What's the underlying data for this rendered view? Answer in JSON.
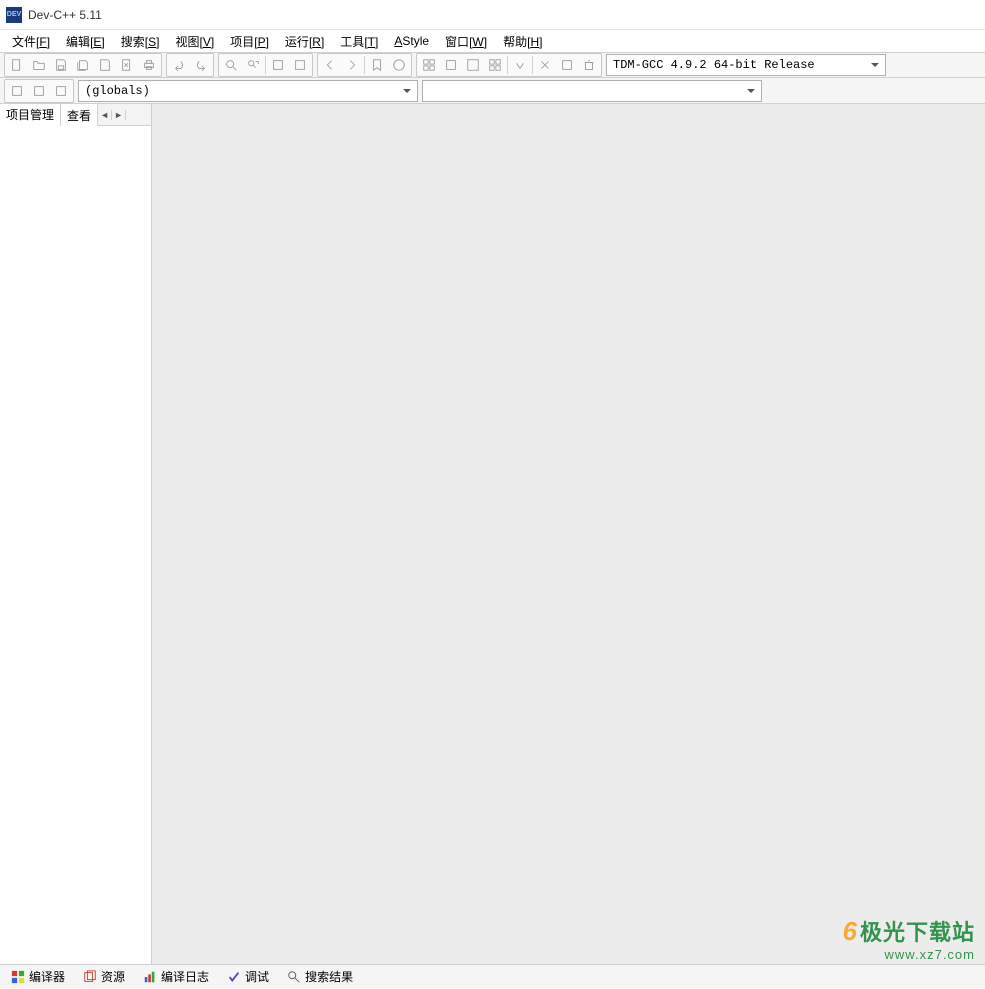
{
  "titlebar": {
    "app_icon_text": "DEV",
    "title": "Dev-C++ 5.11"
  },
  "menubar": [
    {
      "label": "文件",
      "hotkey": "F"
    },
    {
      "label": "编辑",
      "hotkey": "E"
    },
    {
      "label": "搜索",
      "hotkey": "S"
    },
    {
      "label": "视图",
      "hotkey": "V"
    },
    {
      "label": "项目",
      "hotkey": "P"
    },
    {
      "label": "运行",
      "hotkey": "R"
    },
    {
      "label": "工具",
      "hotkey": "T"
    },
    {
      "label": "AStyle",
      "hotkey": ""
    },
    {
      "label": "窗口",
      "hotkey": "W"
    },
    {
      "label": "帮助",
      "hotkey": "H"
    }
  ],
  "toolbar1": {
    "compiler_dropdown": "TDM-GCC 4.9.2 64-bit Release"
  },
  "toolbar2": {
    "globals_dropdown": "(globals)"
  },
  "sidebar": {
    "tabs": [
      "项目管理",
      "查看"
    ],
    "tab1_label": "项目管理",
    "tab2_label": "查看",
    "tab2_truncated": "查看"
  },
  "bottom_tabs": [
    {
      "icon": "compiler-icon",
      "label": "编译器"
    },
    {
      "icon": "resource-icon",
      "label": "资源"
    },
    {
      "icon": "log-icon",
      "label": "编译日志"
    },
    {
      "icon": "debug-icon",
      "label": "调试"
    },
    {
      "icon": "search-icon",
      "label": "搜索结果"
    }
  ],
  "watermark": {
    "brand": "极光下载站",
    "url": "www.xz7.com"
  }
}
